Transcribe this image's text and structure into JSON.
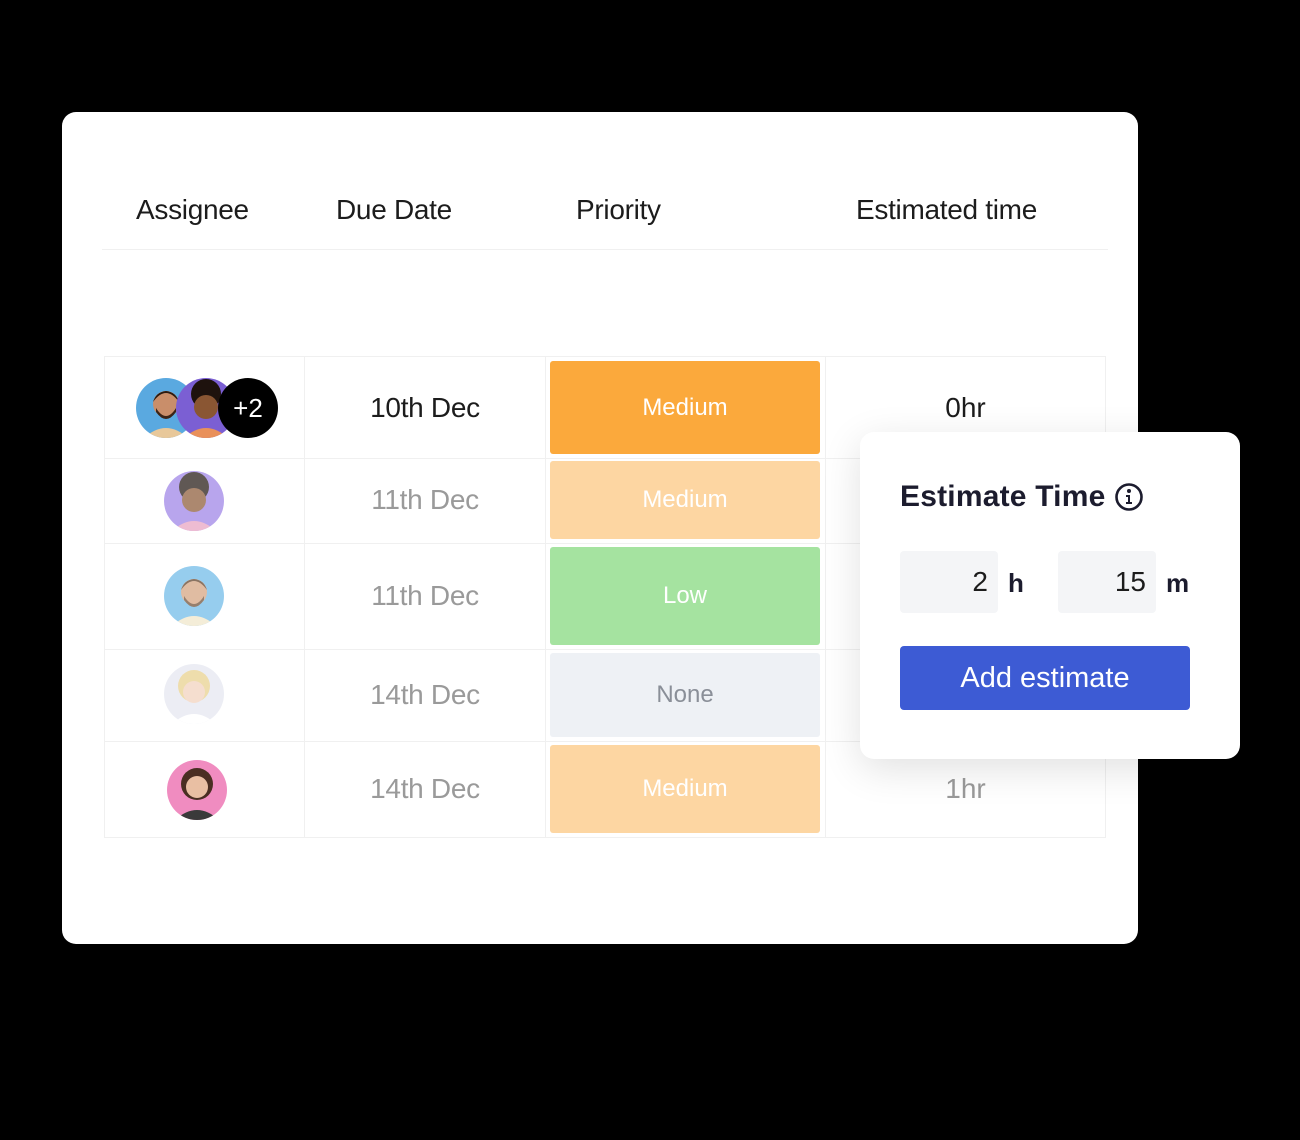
{
  "table": {
    "headers": {
      "assignee": "Assignee",
      "due_date": "Due Date",
      "priority": "Priority",
      "estimated_time": "Estimated time"
    },
    "rows": [
      {
        "due": "10th Dec",
        "priority": "Medium",
        "priority_color": "#fba93c",
        "estimate": "0hr",
        "extra_assignees": "+2"
      },
      {
        "due": "11th Dec",
        "priority": "Medium",
        "priority_color": "#fdd6a2",
        "estimate": ""
      },
      {
        "due": "11th Dec",
        "priority": "Low",
        "priority_color": "#a5e3a0",
        "estimate": ""
      },
      {
        "due": "14th Dec",
        "priority": "None",
        "priority_color": "#eef1f5",
        "estimate": ""
      },
      {
        "due": "14th Dec",
        "priority": "Medium",
        "priority_color": "#fdd6a2",
        "estimate": "1hr"
      }
    ]
  },
  "popup": {
    "title": "Estimate Time",
    "hours_value": "2",
    "hours_unit": "h",
    "minutes_value": "15",
    "minutes_unit": "m",
    "button_label": "Add estimate"
  },
  "colors": {
    "accent": "#3d5bd4",
    "medium": "#fba93c",
    "medium_faded": "#fdd6a2",
    "low": "#a5e3a0",
    "none": "#eef1f5"
  }
}
